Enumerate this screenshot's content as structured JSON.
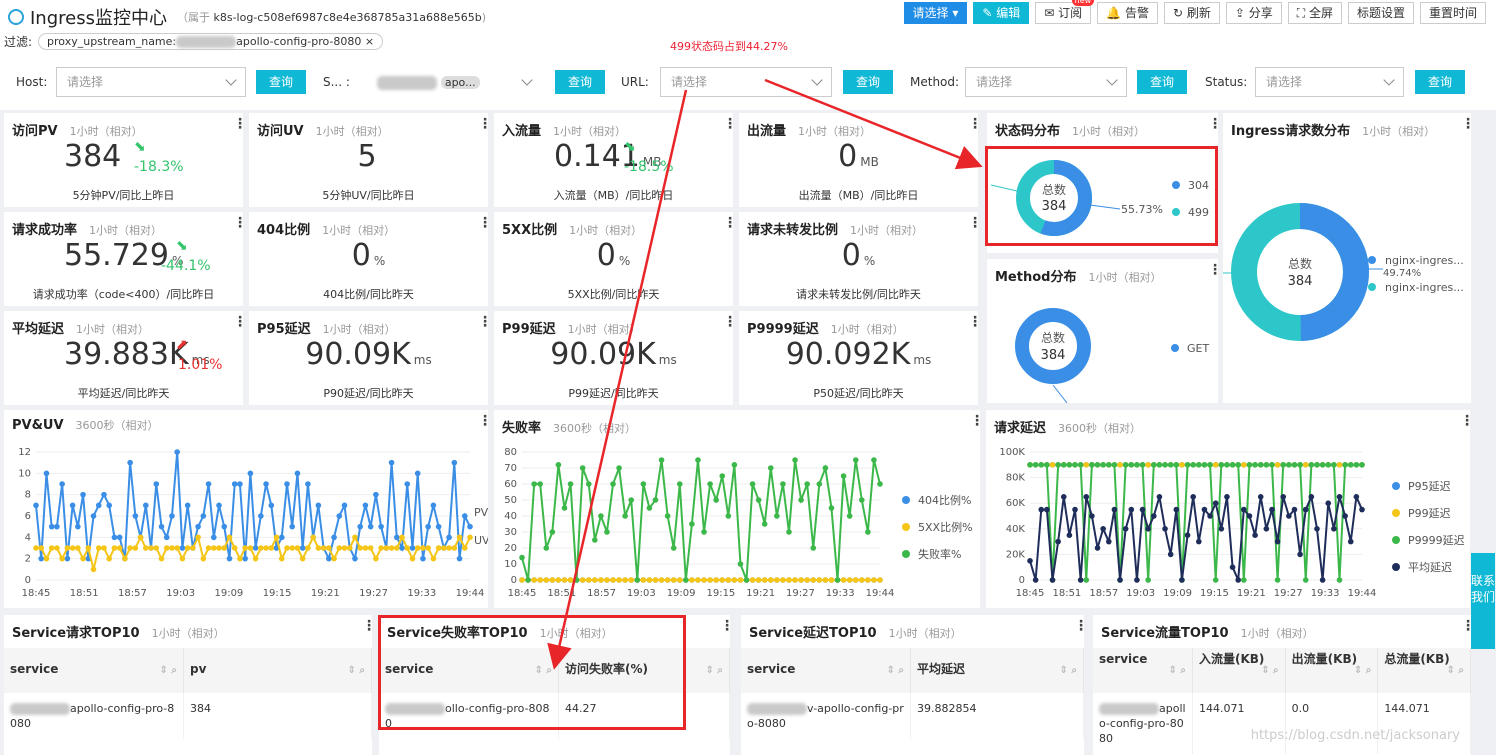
{
  "header": {
    "title": "Ingress监控中心",
    "belong_prefix": "属于",
    "belong_id": "k8s-log-c508ef6987c8e4e368785a31a688e565b",
    "belong_suffix": ")"
  },
  "toolbar": {
    "select": "请选择",
    "edit": "编辑",
    "subscribe": "订阅",
    "new_badge": "new",
    "alert": "告警",
    "refresh": "刷新",
    "share": "分享",
    "fullscreen": "全屏",
    "title_settings": "标题设置",
    "reset_time": "重置时间"
  },
  "filter": {
    "label": "过滤:",
    "chip_key": "proxy_upstream_name:",
    "chip_value": "apollo-config-pro-8080",
    "close": "×"
  },
  "annotation": "499状态码占到44.27%",
  "filters": {
    "host_label": "Host:",
    "host_placeholder": "请选择",
    "s_label": "S... :",
    "s_value": "apo...",
    "url_label": "URL:",
    "url_placeholder": "请选择",
    "method_label": "Method:",
    "method_placeholder": "请选择",
    "status_label": "Status:",
    "status_placeholder": "请选择",
    "query": "查询"
  },
  "metrics": [
    {
      "title": "访问PV",
      "sub": "1小时（相对）",
      "value": "384",
      "unit": "",
      "change": "-18.3%",
      "dir": "down",
      "foot": "5分钟PV/同比上昨日"
    },
    {
      "title": "访问UV",
      "sub": "1小时（相对）",
      "value": "5",
      "unit": "",
      "change": "",
      "dir": "",
      "foot": "5分钟UV/同比昨日"
    },
    {
      "title": "入流量",
      "sub": "1小时（相对）",
      "value": "0.141",
      "unit": "MB",
      "change": "-18.5%",
      "dir": "down",
      "foot": "入流量（MB）/同比昨日"
    },
    {
      "title": "出流量",
      "sub": "1小时（相对）",
      "value": "0",
      "unit": "MB",
      "change": "",
      "dir": "",
      "foot": "出流量（MB）/同比昨日"
    },
    {
      "title": "请求成功率",
      "sub": "1小时（相对）",
      "value": "55.729",
      "unit": "%",
      "change": "-44.1%",
      "dir": "down",
      "foot": "请求成功率（code<400）/同比昨日"
    },
    {
      "title": "404比例",
      "sub": "1小时（相对）",
      "value": "0",
      "unit": "%",
      "change": "",
      "dir": "",
      "foot": "404比例/同比昨天"
    },
    {
      "title": "5XX比例",
      "sub": "1小时（相对）",
      "value": "0",
      "unit": "%",
      "change": "",
      "dir": "",
      "foot": "5XX比例/同比昨天"
    },
    {
      "title": "请求未转发比例",
      "sub": "1小时（相对）",
      "value": "0",
      "unit": "%",
      "change": "",
      "dir": "",
      "foot": "请求未转发比例/同比昨天"
    },
    {
      "title": "平均延迟",
      "sub": "1小时（相对）",
      "value": "39.883K",
      "unit": "ms",
      "change": "1.01%",
      "dir": "up",
      "foot": "平均延迟/同比昨天"
    },
    {
      "title": "P95延迟",
      "sub": "1小时（相对）",
      "value": "90.09K",
      "unit": "ms",
      "change": "",
      "dir": "",
      "foot": "P90延迟/同比昨天"
    },
    {
      "title": "P99延迟",
      "sub": "1小时（相对）",
      "value": "90.09K",
      "unit": "ms",
      "change": "",
      "dir": "",
      "foot": "P99延迟/同比昨天"
    },
    {
      "title": "P9999延迟",
      "sub": "1小时（相对）",
      "value": "90.092K",
      "unit": "ms",
      "change": "",
      "dir": "",
      "foot": "P50延迟/同比昨天"
    }
  ],
  "status_dist": {
    "title": "状态码分布",
    "sub": "1小时（相对）",
    "center_label": "总数",
    "center_value": "384",
    "pct_label": "55.73%",
    "legend": [
      "304",
      "499"
    ],
    "colors": [
      "#3a8ee6",
      "#2ec7c9"
    ]
  },
  "method_dist": {
    "title": "Method分布",
    "sub": "1小时（相对）",
    "center_label": "总数",
    "center_value": "384",
    "legend": [
      "GET"
    ]
  },
  "ingress_dist": {
    "title": "Ingress请求数分布",
    "sub": "1小时（相对）",
    "center_label": "总数",
    "center_value": "384",
    "pct_label": "49.74%",
    "legend": [
      "nginx-ingres...",
      "nginx-ingres..."
    ]
  },
  "pvuv": {
    "title": "PV&UV",
    "sub": "3600秒（相对）",
    "series_labels": [
      "PV",
      "UV"
    ]
  },
  "fail": {
    "title": "失败率",
    "sub": "3600秒（相对）",
    "legend": [
      "404比例%",
      "5XX比例%",
      "失败率%"
    ]
  },
  "latency": {
    "title": "请求延迟",
    "sub": "3600秒（相对）",
    "legend": [
      "P95延迟",
      "P99延迟",
      "P9999延迟",
      "平均延迟"
    ]
  },
  "chart_data": [
    {
      "type": "line",
      "title": "PV&UV",
      "x": [
        "18:45",
        "18:51",
        "18:57",
        "19:03",
        "19:09",
        "19:15",
        "19:21",
        "19:27",
        "19:33",
        "19:44"
      ],
      "yticks": [
        "12",
        "10",
        "8",
        "6",
        "4",
        "2",
        "0"
      ],
      "ylim": [
        0,
        12
      ],
      "series": [
        {
          "name": "PV",
          "values": [
            7,
            2,
            10,
            5,
            5,
            9,
            2,
            7,
            5,
            8,
            2,
            6,
            7,
            8,
            7,
            4,
            4,
            2,
            11,
            6,
            4,
            7,
            3,
            9,
            5,
            4,
            6,
            12,
            3,
            7,
            3,
            5,
            6,
            9,
            4,
            7,
            5,
            2,
            9,
            9,
            2,
            10,
            3,
            6,
            9,
            7,
            3,
            4,
            9,
            5,
            10,
            3,
            9,
            4,
            7,
            3,
            2,
            4,
            6,
            7,
            3,
            2,
            5,
            7,
            5,
            8,
            5,
            3,
            11,
            4,
            3,
            9,
            3,
            10,
            2,
            5,
            7,
            5,
            3,
            4,
            11,
            2,
            6,
            5
          ]
        },
        {
          "name": "UV",
          "values": [
            3,
            3,
            2,
            3,
            3,
            2,
            3,
            3,
            3,
            2,
            3,
            1,
            3,
            3,
            2,
            3,
            3,
            2,
            3,
            3,
            4,
            3,
            3,
            3,
            2,
            3,
            3,
            3,
            2,
            3,
            3,
            4,
            2,
            3,
            3,
            3,
            3,
            4,
            3,
            2,
            3,
            3,
            2,
            3,
            3,
            3,
            4,
            2,
            3,
            3,
            3,
            2,
            3,
            4,
            3,
            3,
            3,
            2,
            3,
            3,
            3,
            4,
            3,
            3,
            3,
            2,
            3,
            3,
            3,
            3,
            4,
            3,
            2,
            3,
            3,
            3,
            2,
            3,
            3,
            3,
            3,
            4,
            3,
            4
          ]
        }
      ]
    },
    {
      "type": "line",
      "title": "失败率",
      "x": [
        "18:45",
        "18:51",
        "18:57",
        "19:03",
        "19:09",
        "19:15",
        "19:21",
        "19:27",
        "19:33",
        "19:44"
      ],
      "yticks": [
        "80",
        "70",
        "60",
        "50",
        "40",
        "30",
        "20",
        "10",
        "0"
      ],
      "ylim": [
        0,
        80
      ],
      "series": [
        {
          "name": "404比例%",
          "values": [
            0,
            0,
            0,
            0,
            0,
            0,
            0,
            0,
            0,
            0,
            0,
            0,
            0,
            0,
            0,
            0,
            0,
            0,
            0,
            0,
            0,
            0,
            0,
            0,
            0,
            0,
            0,
            0,
            0,
            0,
            0,
            0,
            0,
            0,
            0,
            0,
            0,
            0,
            0,
            0,
            0,
            0,
            0,
            0,
            0,
            0,
            0,
            0,
            0,
            0,
            0,
            0,
            0,
            0,
            0,
            0,
            0,
            0,
            0,
            0
          ]
        },
        {
          "name": "5XX比例%",
          "values": [
            0,
            0,
            0,
            0,
            0,
            0,
            0,
            0,
            0,
            0,
            0,
            0,
            0,
            0,
            0,
            0,
            0,
            0,
            0,
            0,
            0,
            0,
            0,
            0,
            0,
            0,
            0,
            0,
            0,
            0,
            0,
            0,
            0,
            0,
            0,
            0,
            0,
            0,
            0,
            0,
            0,
            0,
            0,
            0,
            0,
            0,
            0,
            0,
            0,
            0,
            0,
            0,
            0,
            0,
            0,
            0,
            0,
            0,
            0,
            0
          ]
        },
        {
          "name": "失败率%",
          "values": [
            14,
            0,
            60,
            60,
            20,
            30,
            72,
            45,
            60,
            0,
            70,
            60,
            25,
            40,
            30,
            60,
            70,
            40,
            50,
            0,
            60,
            45,
            50,
            75,
            40,
            20,
            60,
            0,
            35,
            75,
            30,
            60,
            50,
            65,
            40,
            72,
            10,
            0,
            60,
            50,
            35,
            70,
            40,
            60,
            30,
            75,
            50,
            60,
            20,
            60,
            70,
            45,
            0,
            65,
            40,
            75,
            50,
            30,
            75,
            60
          ]
        }
      ]
    },
    {
      "type": "line",
      "title": "请求延迟",
      "x": [
        "18:45",
        "18:51",
        "18:57",
        "19:03",
        "19:09",
        "19:15",
        "19:21",
        "19:27",
        "19:33",
        "19:44"
      ],
      "yticks": [
        "100K",
        "80K",
        "60K",
        "40K",
        "20K",
        "0"
      ],
      "ylim": [
        0,
        100000
      ],
      "series": [
        {
          "name": "P95延迟",
          "values": [
            90000,
            90000,
            90000,
            90000,
            90000,
            90000,
            90000,
            90000,
            90000,
            90000,
            90000,
            90000,
            90000,
            90000,
            90000,
            90000,
            90000,
            90000,
            90000,
            90000,
            90000,
            90000,
            90000,
            90000,
            90000,
            90000,
            90000,
            90000,
            90000,
            90000,
            90000,
            90000,
            90000,
            90000,
            90000,
            90000,
            90000,
            90000,
            90000,
            90000,
            90000,
            90000,
            90000,
            90000,
            90000,
            90000,
            90000,
            90000,
            90000,
            90000,
            90000,
            90000,
            90000,
            90000,
            90000,
            90000,
            90000,
            90000,
            90000,
            90000
          ]
        },
        {
          "name": "P99延迟",
          "values": [
            90000,
            90000,
            90000,
            90000,
            90000,
            90000,
            90000,
            90000,
            90000,
            90000,
            90000,
            90000,
            90000,
            90000,
            90000,
            90000,
            90000,
            90000,
            90000,
            90000,
            90000,
            90000,
            90000,
            90000,
            90000,
            90000,
            90000,
            90000,
            90000,
            90000,
            90000,
            90000,
            90000,
            90000,
            90000,
            90000,
            90000,
            90000,
            90000,
            90000,
            90000,
            90000,
            90000,
            90000,
            90000,
            90000,
            90000,
            90000,
            90000,
            90000,
            90000,
            90000,
            90000,
            90000,
            90000,
            90000,
            90000,
            90000,
            90000,
            90000
          ]
        },
        {
          "name": "P9999延迟",
          "values": [
            90000,
            90000,
            90000,
            90000,
            0,
            90000,
            90000,
            90000,
            90000,
            90000,
            0,
            90000,
            90000,
            90000,
            90000,
            90000,
            0,
            90000,
            90000,
            90000,
            90000,
            0,
            90000,
            90000,
            90000,
            90000,
            90000,
            0,
            90000,
            90000,
            90000,
            90000,
            90000,
            0,
            90000,
            90000,
            90000,
            90000,
            0,
            90000,
            90000,
            90000,
            90000,
            90000,
            0,
            90000,
            90000,
            90000,
            90000,
            0,
            90000,
            90000,
            90000,
            90000,
            90000,
            0,
            90000,
            90000,
            90000,
            90000
          ]
        },
        {
          "name": "平均延迟",
          "values": [
            15000,
            0,
            55000,
            55000,
            0,
            30000,
            65000,
            35000,
            55000,
            0,
            65000,
            50000,
            25000,
            40000,
            30000,
            55000,
            0,
            40000,
            55000,
            0,
            55000,
            40000,
            50000,
            65000,
            40000,
            20000,
            55000,
            0,
            35000,
            65000,
            30000,
            55000,
            50000,
            60000,
            40000,
            65000,
            10000,
            0,
            55000,
            50000,
            35000,
            65000,
            40000,
            55000,
            30000,
            65000,
            50000,
            55000,
            20000,
            55000,
            65000,
            40000,
            0,
            60000,
            40000,
            65000,
            50000,
            30000,
            65000,
            55000
          ]
        }
      ]
    }
  ],
  "tables": [
    {
      "title": "Service请求TOP10",
      "sub": "1小时（相对）",
      "cols": [
        "service",
        "pv"
      ],
      "rows": [
        [
          "apollo-config-pro-8080",
          "384"
        ]
      ]
    },
    {
      "title": "Service失败率TOP10",
      "sub": "1小时（相对）",
      "cols": [
        "service",
        "访问失败率(%)"
      ],
      "rows": [
        [
          "ollo-config-pro-8080",
          "44.27"
        ]
      ]
    },
    {
      "title": "Service延迟TOP10",
      "sub": "1小时（相对）",
      "cols": [
        "service",
        "平均延迟"
      ],
      "rows": [
        [
          "v-apollo-config-pro-8080",
          "39.882854"
        ]
      ]
    },
    {
      "title": "Service流量TOP10",
      "sub": "1小时（相对）",
      "cols": [
        "service",
        "入流量(KB)",
        "出流量(KB)",
        "总流量(KB)"
      ],
      "rows": [
        [
          "apollo-config-pro-8080",
          "144.071",
          "0.0",
          "144.071"
        ]
      ]
    }
  ],
  "side_contact": "联系我们",
  "watermark": "https://blog.csdn.net/jacksonary"
}
